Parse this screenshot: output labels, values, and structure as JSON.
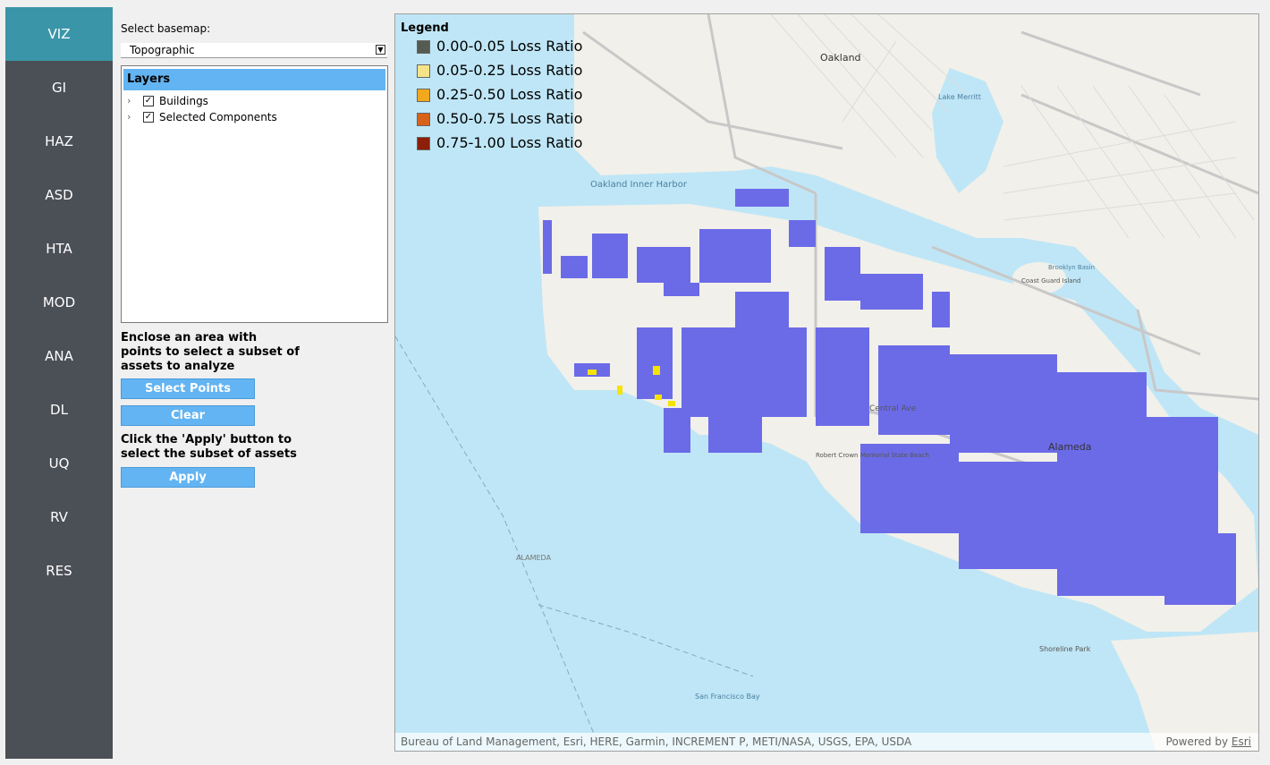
{
  "nav": {
    "items": [
      "VIZ",
      "GI",
      "HAZ",
      "ASD",
      "HTA",
      "MOD",
      "ANA",
      "DL",
      "UQ",
      "RV",
      "RES"
    ],
    "active": "VIZ",
    "bg_color": "#4b4f56",
    "active_color": "#3a95a8"
  },
  "basemap": {
    "label": "Select basemap:",
    "value": "Topographic"
  },
  "layers": {
    "header": "Layers",
    "items": [
      {
        "label": "Buildings",
        "checked": true
      },
      {
        "label": "Selected Components",
        "checked": true
      }
    ]
  },
  "selection": {
    "instruction1": "Enclose an area with points to select a subset of assets to analyze",
    "select_points_label": "Select Points",
    "clear_label": "Clear",
    "instruction2": "Click the 'Apply' button to select the subset of assets",
    "apply_label": "Apply"
  },
  "legend": {
    "title": "Legend",
    "items": [
      {
        "label": "0.00-0.05 Loss Ratio",
        "color": "#555b50"
      },
      {
        "label": "0.05-0.25 Loss Ratio",
        "color": "#f5e38a"
      },
      {
        "label": "0.25-0.50 Loss Ratio",
        "color": "#f2a81d"
      },
      {
        "label": "0.50-0.75 Loss Ratio",
        "color": "#d9621a"
      },
      {
        "label": "0.75-1.00 Loss Ratio",
        "color": "#8c1f0a"
      }
    ]
  },
  "map": {
    "labels": {
      "oakland": "Oakland",
      "alameda": "Alameda",
      "inner_harbor": "Oakland Inner Harbor",
      "sf_bay": "San Francisco Bay",
      "lake_merritt": "Lake Merritt",
      "central_ave": "Central Ave",
      "coast_guard": "Coast Guard Island",
      "brooklyn_basin": "Brooklyn Basin",
      "alameda_sf_ferry": "ALAMEDA",
      "shoreline_park": "Shoreline Park",
      "robert_crown": "Robert Crown Memorial State Beach"
    },
    "building_color": "#6b6be8",
    "water_color": "#bfe6f6",
    "land_color": "#f2f0ea"
  },
  "attribution": {
    "left": "Bureau of Land Management, Esri, HERE, Garmin, INCREMENT P, METI/NASA, USGS, EPA, USDA",
    "right_prefix": "Powered by ",
    "right_link": "Esri"
  }
}
